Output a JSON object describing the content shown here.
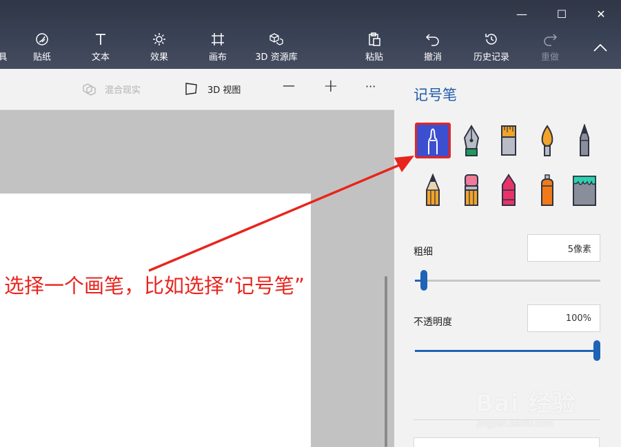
{
  "window": {
    "minimize_glyph": "—",
    "maximize_glyph": "☐",
    "close_glyph": "✕"
  },
  "ribbon": {
    "partial_label": "具",
    "tools": [
      {
        "label": "贴纸",
        "icon": "sticker-icon"
      },
      {
        "label": "文本",
        "icon": "text-icon"
      },
      {
        "label": "效果",
        "icon": "effects-icon"
      },
      {
        "label": "画布",
        "icon": "canvas-icon"
      },
      {
        "label": "3D 资源库",
        "icon": "3d-library-icon"
      },
      {
        "label": "粘贴",
        "icon": "paste-icon"
      },
      {
        "label": "撤消",
        "icon": "undo-icon"
      },
      {
        "label": "历史记录",
        "icon": "history-icon"
      },
      {
        "label": "重做",
        "icon": "redo-icon",
        "disabled": true
      }
    ],
    "collapse_icon": "chevron-up-icon"
  },
  "subbar": {
    "mixed_reality": "混合现实",
    "view_3d": "3D 视图",
    "zoom_out_glyph": "—",
    "zoom_in_glyph": "+",
    "more_glyph": "···"
  },
  "canvas": {
    "annotation": "选择一个画笔，比如选择“记号笔”"
  },
  "panel": {
    "title": "记号笔",
    "brushes": [
      {
        "name": "marker",
        "selected": true
      },
      {
        "name": "calligraphy-pen"
      },
      {
        "name": "oil-brush"
      },
      {
        "name": "watercolor"
      },
      {
        "name": "pixel-pen"
      },
      {
        "name": "pencil"
      },
      {
        "name": "eraser"
      },
      {
        "name": "crayon"
      },
      {
        "name": "spray-can"
      },
      {
        "name": "fill-bucket"
      }
    ],
    "thickness": {
      "label": "粗细",
      "value": "5像素",
      "level": 0.05
    },
    "opacity": {
      "label": "不透明度",
      "value": "100%",
      "level": 1.0
    }
  },
  "colors": {
    "accent": "#1e63b5",
    "annotation": "#e8241c",
    "selected_brush_bg": "#3b4fd0"
  },
  "watermark": {
    "brand": "Bai 经验",
    "url": "jingyan.baidu.com"
  }
}
